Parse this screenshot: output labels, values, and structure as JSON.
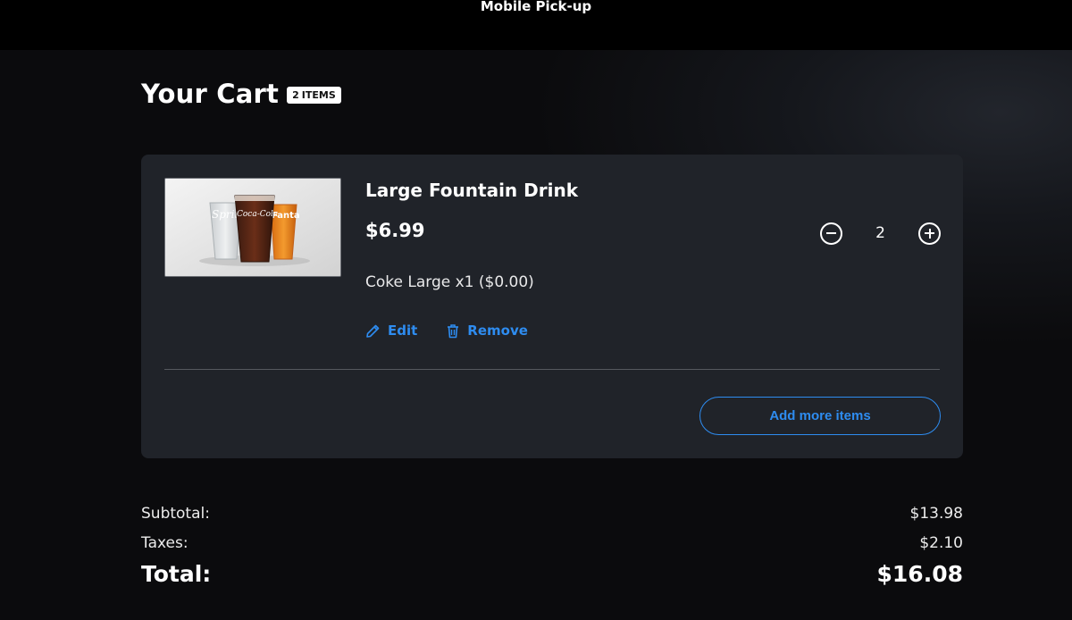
{
  "header": {
    "title": "Mobile Pick-up"
  },
  "cart": {
    "title": "Your Cart",
    "count": "2",
    "count_label": "ITEMS"
  },
  "item": {
    "name": "Large Fountain Drink",
    "price": "$6.99",
    "quantity": "2",
    "options": "Coke Large x1 ($0.00)",
    "edit_label": "Edit",
    "remove_label": "Remove",
    "image_cups": [
      "Sprite",
      "Coca-Cola",
      "Fanta"
    ]
  },
  "add_more_label": "Add more items",
  "summary": {
    "subtotal_label": "Subtotal:",
    "subtotal_value": "$13.98",
    "taxes_label": "Taxes:",
    "taxes_value": "$2.10",
    "total_label": "Total:",
    "total_value": "$16.08"
  },
  "colors": {
    "accent": "#2e8cf0",
    "card": "#202329",
    "background": "#0b0b0d"
  },
  "icons": {
    "minus": "minus-circle-icon",
    "plus": "plus-circle-icon",
    "edit": "pencil-icon",
    "remove": "trash-icon"
  }
}
